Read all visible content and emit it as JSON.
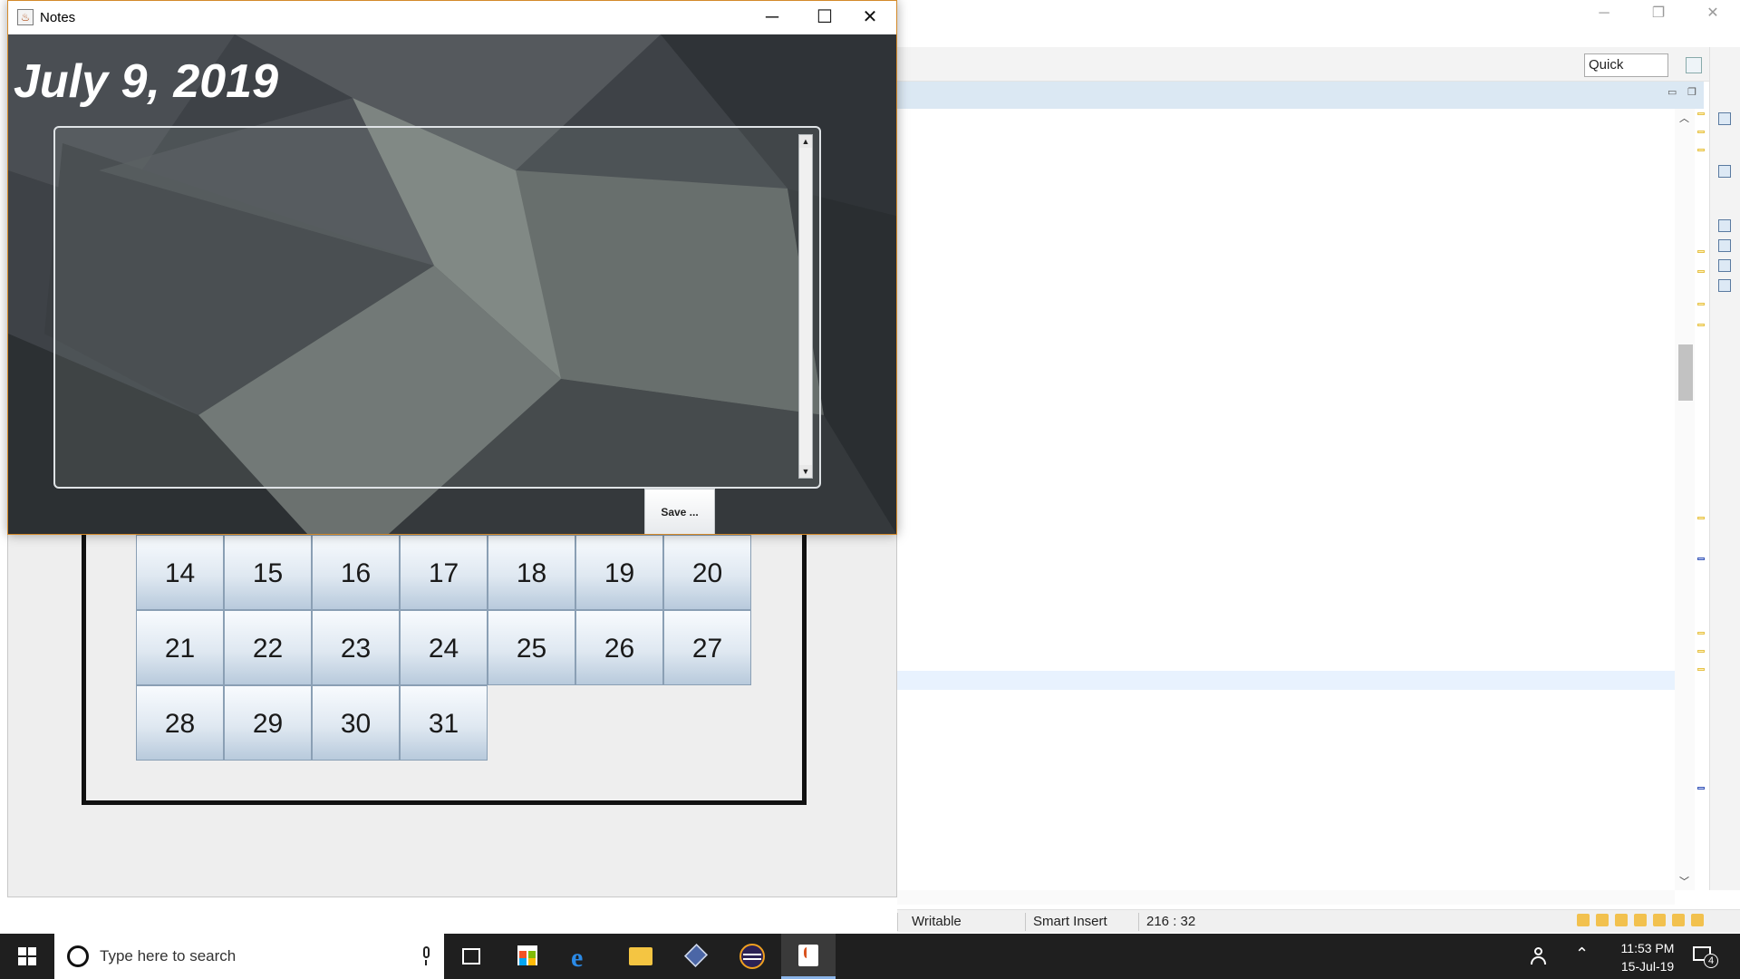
{
  "ide": {
    "quick_access_label": "Quick Access",
    "status": {
      "writable": "Writable",
      "insert_mode": "Smart Insert",
      "cursor_position": "216 : 32"
    },
    "window_controls": [
      "minimize-icon",
      "restore-icon",
      "close-icon"
    ]
  },
  "notes_window": {
    "title": "Notes",
    "date_heading": "July 9, 2019",
    "note_text": "",
    "save_button": "Save ...",
    "controls": {
      "minimize": "─",
      "maximize": "☐",
      "close": "✕"
    }
  },
  "calendar": {
    "rows": [
      [
        "14",
        "15",
        "16",
        "17",
        "18",
        "19",
        "20"
      ],
      [
        "21",
        "22",
        "23",
        "24",
        "25",
        "26",
        "27"
      ],
      [
        "28",
        "29",
        "30",
        "31"
      ]
    ]
  },
  "taskbar": {
    "search_placeholder": "Type here to search",
    "apps": [
      "task-view",
      "microsoft-store",
      "edge",
      "file-explorer",
      "virtualbox",
      "eclipse",
      "java"
    ],
    "active_app": "java",
    "time": "11:53 PM",
    "date": "15-Jul-19",
    "notification_count": "4"
  },
  "colors": {
    "notes_border": "#d48a2a",
    "day_button_top": "#f8fbfe",
    "day_button_bottom": "#b8cadc",
    "taskbar": "#1f1f1f",
    "editor_header": "#dbe8f3"
  }
}
